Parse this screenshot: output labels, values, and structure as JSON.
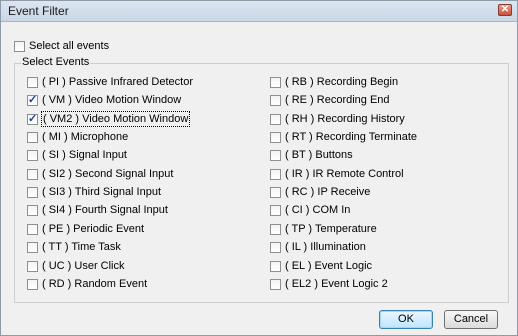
{
  "window": {
    "title": "Event Filter",
    "close_glyph": "✕"
  },
  "select_all": {
    "label": "Select all events",
    "checked": false
  },
  "group_label": "Select Events",
  "events_left": [
    {
      "label": "( PI ) Passive Infrared Detector",
      "checked": false
    },
    {
      "label": "( VM ) Video Motion Window",
      "checked": true
    },
    {
      "label": "( VM2 ) Video Motion Window",
      "checked": true,
      "focused": true
    },
    {
      "label": "( MI ) Microphone",
      "checked": false
    },
    {
      "label": "( SI ) Signal Input",
      "checked": false
    },
    {
      "label": "( SI2 ) Second Signal Input",
      "checked": false
    },
    {
      "label": "( SI3 ) Third Signal Input",
      "checked": false
    },
    {
      "label": "( SI4 ) Fourth Signal Input",
      "checked": false
    },
    {
      "label": "( PE ) Periodic Event",
      "checked": false
    },
    {
      "label": "( TT ) Time Task",
      "checked": false
    },
    {
      "label": "( UC ) User Click",
      "checked": false
    },
    {
      "label": "( RD ) Random Event",
      "checked": false
    }
  ],
  "events_right": [
    {
      "label": "( RB ) Recording Begin",
      "checked": false
    },
    {
      "label": "( RE ) Recording End",
      "checked": false
    },
    {
      "label": "( RH ) Recording History",
      "checked": false
    },
    {
      "label": "( RT ) Recording Terminate",
      "checked": false
    },
    {
      "label": "( BT ) Buttons",
      "checked": false
    },
    {
      "label": "( IR ) IR Remote Control",
      "checked": false
    },
    {
      "label": "( RC ) IP Receive",
      "checked": false
    },
    {
      "label": "( CI ) COM In",
      "checked": false
    },
    {
      "label": "( TP ) Temperature",
      "checked": false
    },
    {
      "label": "( IL ) Illumination",
      "checked": false
    },
    {
      "label": "( EL ) Event Logic",
      "checked": false
    },
    {
      "label": "( EL2 ) Event Logic 2",
      "checked": false
    }
  ],
  "buttons": {
    "ok": "OK",
    "cancel": "Cancel"
  }
}
